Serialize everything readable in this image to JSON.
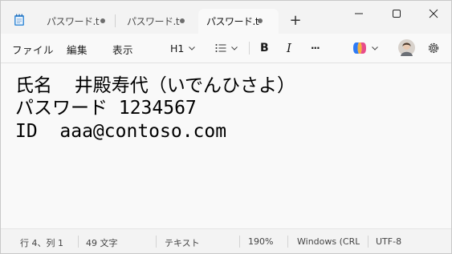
{
  "tabs": [
    {
      "label": "パスワード.t",
      "active": false,
      "unsaved": true
    },
    {
      "label": "パスワード.t",
      "active": false,
      "unsaved": true
    },
    {
      "label": "パスワード.t",
      "active": true,
      "unsaved": true
    }
  ],
  "new_tab_label": "+",
  "menu": {
    "file": "ファイル",
    "edit": "編集",
    "view": "表示"
  },
  "toolbar": {
    "heading": "H1",
    "bold": "B",
    "italic": "I",
    "more": "···"
  },
  "document": {
    "lines": [
      "氏名  井殿寿代（いでんひさよ）",
      "パスワード 1234567",
      "ID  aaa@contoso.com"
    ]
  },
  "status": {
    "position": "行 4、列 1",
    "chars": "49 文字",
    "format": "テキスト",
    "zoom": "190%",
    "line_ending": "Windows (CRL",
    "encoding": "UTF-8"
  },
  "colors": {
    "accent": "#0067c0",
    "copilot": "#2f7bf5"
  }
}
